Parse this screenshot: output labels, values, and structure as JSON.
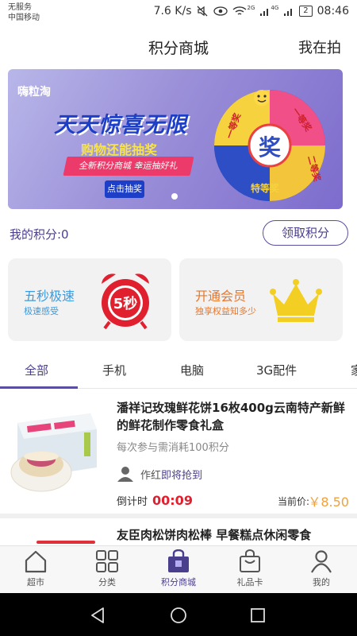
{
  "status_bar": {
    "line1": "无服务",
    "line2": "中国移动",
    "speed": "7.6 K/s",
    "icons": [
      "mute-icon",
      "eye-icon",
      "wifi-icon",
      "signal-icon"
    ],
    "network1": "2G",
    "network2": "4G",
    "battery": "2",
    "time": "08:46"
  },
  "header": {
    "title": "积分商城",
    "action": "我在拍"
  },
  "banner": {
    "brand": "嗨粒淘",
    "slogan": "天天惊喜无限",
    "subtitle": "购物还能抽奖",
    "ribbon": "全新积分商城  幸运抽好礼",
    "button": "点击抽奖",
    "wheel": {
      "center": "奖",
      "sectors": [
        "一等奖",
        "一等奖",
        "二等奖",
        "特等奖"
      ]
    },
    "dots": 1
  },
  "points": {
    "label": "我的积分:0",
    "claim_button": "领取积分"
  },
  "cards": [
    {
      "title": "五秒极速",
      "subtitle": "极速感受",
      "badge": "5秒",
      "icon": "alarm-clock-icon"
    },
    {
      "title": "开通会员",
      "subtitle": "独享权益知多少",
      "icon": "crown-icon"
    }
  ],
  "tabs": [
    "全部",
    "手机",
    "电脑",
    "3G配件",
    "家"
  ],
  "active_tab": "全部",
  "products": [
    {
      "title": "潘祥记玫瑰鲜花饼16枚400g云南特产新鲜的鲜花制作零食礼盒",
      "cost_text": "每次参与需消耗100积分",
      "user": "作红",
      "user_status": "即将抢到",
      "countdown_label": "倒计时",
      "countdown": "00:09",
      "price_label": "当前价:",
      "price": "￥8.50"
    },
    {
      "title": "友臣肉松饼肉松棒 早餐糕点休闲零食"
    }
  ],
  "bottom_nav": [
    {
      "label": "超市",
      "icon": "home-icon"
    },
    {
      "label": "分类",
      "icon": "grid-icon"
    },
    {
      "label": "积分商城",
      "icon": "shopping-bag-icon",
      "active": true
    },
    {
      "label": "礼品卡",
      "icon": "gift-bag-icon"
    },
    {
      "label": "我的",
      "icon": "user-icon"
    }
  ],
  "colors": {
    "accent": "#4a3f8c",
    "timer": "#e0202e",
    "price": "#f2a03a",
    "card_blue": "#3a9be0",
    "card_orange": "#e9762a"
  }
}
